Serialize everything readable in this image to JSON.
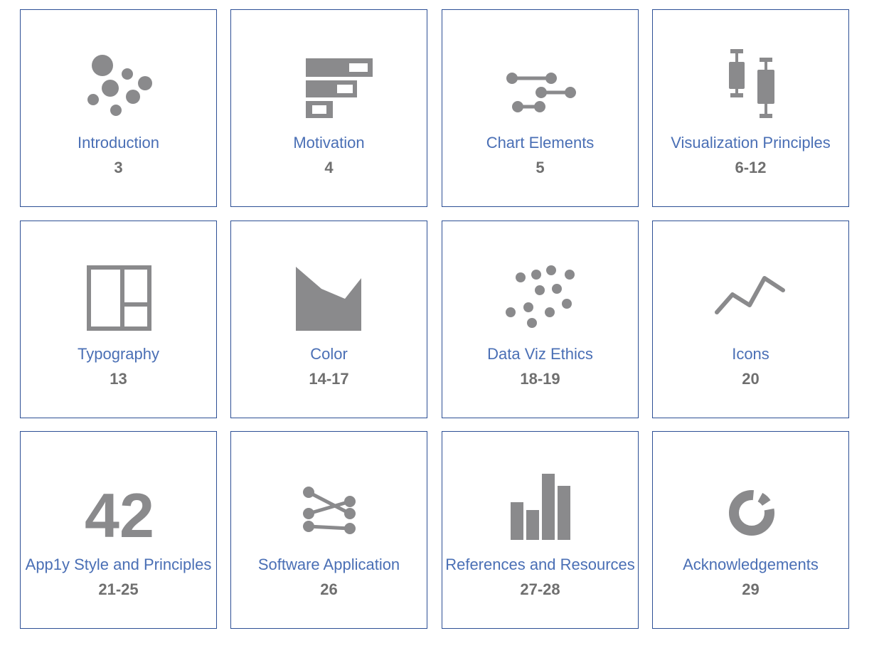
{
  "sections": [
    {
      "label": "Introduction",
      "pages": "3",
      "icon": "bubble-cluster-icon"
    },
    {
      "label": "Motivation",
      "pages": "4",
      "icon": "progress-bars-icon"
    },
    {
      "label": "Chart Elements",
      "pages": "5",
      "icon": "slider-lines-icon"
    },
    {
      "label": "Visualization Principles",
      "pages": "6-12",
      "icon": "box-plot-icon"
    },
    {
      "label": "Typography",
      "pages": "13",
      "icon": "layout-grid-icon"
    },
    {
      "label": "Color",
      "pages": "14-17",
      "icon": "area-shape-icon"
    },
    {
      "label": "Data Viz Ethics",
      "pages": "18-19",
      "icon": "scatter-dots-icon"
    },
    {
      "label": "Icons",
      "pages": "20",
      "icon": "line-trend-icon"
    },
    {
      "label": "App1y Style and Principles",
      "pages": "21-25",
      "icon": "number-42-icon",
      "icon_text": "42"
    },
    {
      "label": "Software Application",
      "pages": "26",
      "icon": "crossing-connections-icon"
    },
    {
      "label": "References and Resources",
      "pages": "27-28",
      "icon": "bar-chart-icon"
    },
    {
      "label": "Acknowledgements",
      "pages": "29",
      "icon": "donut-chart-icon"
    }
  ],
  "colors": {
    "border": "#2d4f95",
    "label": "#4a6fb5",
    "pages": "#6f6f6f",
    "icon": "#8a8a8c"
  }
}
